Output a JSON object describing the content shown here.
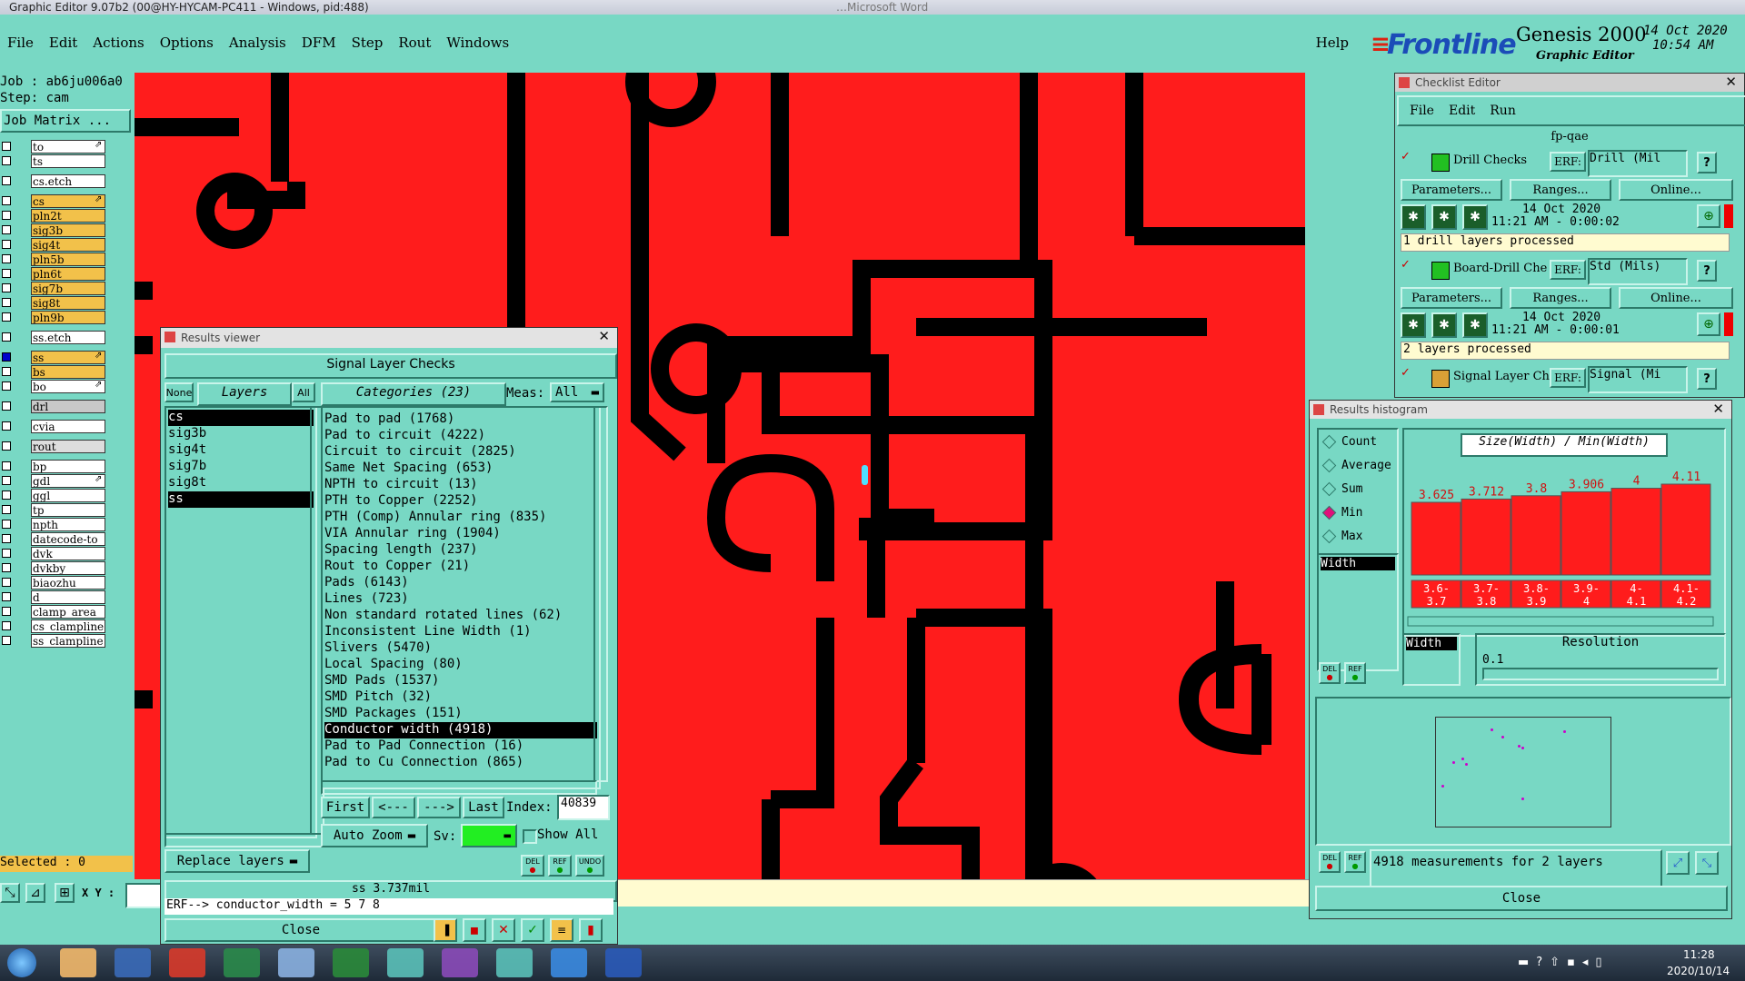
{
  "window_title": "Graphic Editor 9.07b2 (00@HY-HYCAM-PC411 - Windows, pid:488)",
  "bg_title_text": "…Microsoft Word",
  "menu": [
    "File",
    "Edit",
    "Actions",
    "Options",
    "Analysis",
    "DFM",
    "Step",
    "Rout",
    "Windows"
  ],
  "help": "Help",
  "brand": {
    "logo": "Frontline",
    "product": "Genesis 2000",
    "subtitle": "Graphic Editor",
    "date": "14 Oct 2020",
    "time": "10:54 AM"
  },
  "job": {
    "job": "Job : ab6ju006a0",
    "step": "Step: cam",
    "matrix": "Job Matrix ..."
  },
  "layers": [
    {
      "name": "to",
      "color": "#ffffff",
      "arrow": "⇗"
    },
    {
      "name": "ts",
      "color": "#ffffff",
      "arrow": ""
    },
    {
      "name": "cs.etch",
      "color": "#ffffff",
      "arrow": ""
    },
    {
      "name": "cs",
      "color": "#f2c14a",
      "arrow": "⇗"
    },
    {
      "name": "pln2t",
      "color": "#f2c14a",
      "arrow": ""
    },
    {
      "name": "sig3b",
      "color": "#f2c14a",
      "arrow": ""
    },
    {
      "name": "sig4t",
      "color": "#f2c14a",
      "arrow": ""
    },
    {
      "name": "pln5b",
      "color": "#f2c14a",
      "arrow": ""
    },
    {
      "name": "pln6t",
      "color": "#f2c14a",
      "arrow": ""
    },
    {
      "name": "sig7b",
      "color": "#f2c14a",
      "arrow": ""
    },
    {
      "name": "sig8t",
      "color": "#f2c14a",
      "arrow": ""
    },
    {
      "name": "pln9b",
      "color": "#f2c14a",
      "arrow": ""
    },
    {
      "name": "ss.etch",
      "color": "#ffffff",
      "arrow": ""
    },
    {
      "name": "ss",
      "color": "#f2c14a",
      "arrow": "⇗"
    },
    {
      "name": "bs",
      "color": "#f2c14a",
      "arrow": ""
    },
    {
      "name": "bo",
      "color": "#ffffff",
      "arrow": "⇗"
    },
    {
      "name": "drl",
      "color": "#c8c8c8",
      "arrow": ""
    },
    {
      "name": "cvia",
      "color": "#ffffff",
      "arrow": ""
    },
    {
      "name": "rout",
      "color": "#dddddd",
      "arrow": ""
    },
    {
      "name": "bp",
      "color": "#ffffff",
      "arrow": ""
    },
    {
      "name": "gdl",
      "color": "#ffffff",
      "arrow": "⇗"
    },
    {
      "name": "ggl",
      "color": "#ffffff",
      "arrow": ""
    },
    {
      "name": "tp",
      "color": "#ffffff",
      "arrow": ""
    },
    {
      "name": "npth",
      "color": "#ffffff",
      "arrow": ""
    },
    {
      "name": "datecode-to",
      "color": "#ffffff",
      "arrow": ""
    },
    {
      "name": "dvk",
      "color": "#ffffff",
      "arrow": ""
    },
    {
      "name": "dvkby",
      "color": "#ffffff",
      "arrow": ""
    },
    {
      "name": "biaozhu",
      "color": "#ffffff",
      "arrow": ""
    },
    {
      "name": "d",
      "color": "#ffffff",
      "arrow": ""
    },
    {
      "name": "clamp_area",
      "color": "#ffffff",
      "arrow": ""
    },
    {
      "name": "cs_clampline",
      "color": "#ffffff",
      "arrow": ""
    },
    {
      "name": "ss_clampline",
      "color": "#ffffff",
      "arrow": ""
    }
  ],
  "selected": "Selected : 0",
  "coord_label": "X Y :",
  "results_viewer": {
    "title": "Results viewer",
    "header": "Signal Layer Checks",
    "none_btn": "None",
    "layers_label": "Layers",
    "all_btn": "All",
    "categories_label": "Categories (23)",
    "meas_label": "Meas:",
    "meas_value": "All",
    "layers": [
      "cs",
      "sig3b",
      "sig4t",
      "sig7b",
      "sig8t",
      "ss"
    ],
    "categories": [
      "Pad to pad (1768)",
      "Pad to circuit (4222)",
      "Circuit to circuit (2825)",
      "Same Net Spacing (653)",
      "NPTH to circuit (13)",
      "PTH to Copper (2252)",
      "PTH (Comp) Annular ring (835)",
      "VIA Annular ring (1904)",
      "Spacing length (237)",
      "Rout to Copper (21)",
      "Pads (6143)",
      "Lines (723)",
      "Non standard rotated lines (62)",
      "Inconsistent Line Width (1)",
      "Slivers (5470)",
      "Local Spacing (80)",
      "SMD Pads (1537)",
      "SMD Pitch (32)",
      "SMD Packages (151)",
      "Conductor width (4918)",
      "Pad to Pad Connection (16)",
      "Pad to Cu Connection (865)"
    ],
    "first": "First",
    "prev": "<---",
    "next": "--->",
    "last": "Last",
    "index_label": "Index:",
    "index_value": "40839",
    "auto_zoom": "Auto Zoom",
    "sv_label": "Sv:",
    "show_all": "Show All",
    "replace_layers": "Replace layers",
    "del": "DEL",
    "ref": "REF",
    "undo": "UNDO",
    "status": "ss 3.737mil",
    "erf": "ERF--> conductor_width = 5 7 8",
    "close": "Close"
  },
  "checklist": {
    "title": "Checklist Editor",
    "menu": [
      "File",
      "Edit",
      "Run"
    ],
    "name": "fp-qae",
    "erf_label": "ERF:",
    "checks": [
      {
        "name": "Drill Checks",
        "erf": "Drill (Mil",
        "date": "14 Oct 2020",
        "time": "11:21 AM - 0:00:02",
        "msg": "1 drill layers processed"
      },
      {
        "name": "Board-Drill Che",
        "erf": "Std (Mils)",
        "date": "14 Oct 2020",
        "time": "11:21 AM - 0:00:01",
        "msg": "2 layers processed"
      },
      {
        "name": "Signal Layer Ch",
        "erf": "Signal (Mi"
      }
    ],
    "parameters": "Parameters...",
    "ranges": "Ranges...",
    "online": "Online..."
  },
  "histogram": {
    "title": "Results histogram",
    "options": [
      "Count",
      "Average",
      "Sum",
      "Min",
      "Max"
    ],
    "selected_option": "Min",
    "metric": "Width",
    "chart_title": "Size(Width) / Min(Width)",
    "resolution_label": "Resolution",
    "resolution_value": "0.1",
    "width_label": "Width",
    "summary": "4918 measurements for 2 layers",
    "close": "Close",
    "del": "DEL",
    "ref": "REF"
  },
  "chart_data": {
    "type": "bar",
    "title": "Size(Width) / Min(Width)",
    "categories": [
      "3.6-3.7",
      "3.7-3.8",
      "3.8-3.9",
      "3.9-4",
      "4-4.1",
      "4.1-4.2"
    ],
    "values": [
      3.625,
      3.712,
      3.8,
      3.906,
      4,
      4.11
    ],
    "value_labels": [
      "3.625",
      "3.712",
      "3.8",
      "3.906",
      "4",
      "4.11"
    ],
    "cat_top": [
      "3.6-",
      "3.7-",
      "3.8-",
      "3.9-",
      "4-",
      "4.1-"
    ],
    "cat_bot": [
      "3.7",
      "3.8",
      "3.9",
      "4",
      "4.1",
      "4.2"
    ],
    "color": "#ff1c1c"
  },
  "taskbar": {
    "time": "11:28",
    "date": "2020/10/14"
  }
}
